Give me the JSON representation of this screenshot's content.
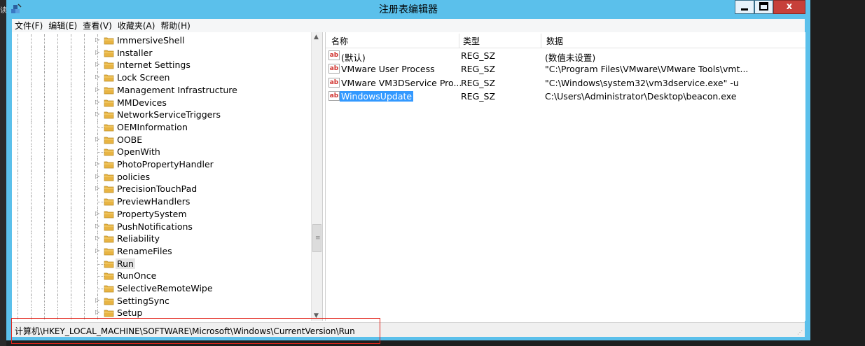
{
  "window": {
    "title": "注册表编辑器",
    "close_label": "x"
  },
  "left_edge": {
    "char": "读"
  },
  "menu": [
    {
      "label": "文件(F)"
    },
    {
      "label": "编辑(E)"
    },
    {
      "label": "查看(V)"
    },
    {
      "label": "收藏夹(A)"
    },
    {
      "label": "帮助(H)"
    }
  ],
  "tree": {
    "items": [
      {
        "label": "ImmersiveShell",
        "expandable": true
      },
      {
        "label": "Installer",
        "expandable": true
      },
      {
        "label": "Internet Settings",
        "expandable": true
      },
      {
        "label": "Lock Screen",
        "expandable": true
      },
      {
        "label": "Management Infrastructure",
        "expandable": true
      },
      {
        "label": "MMDevices",
        "expandable": true
      },
      {
        "label": "NetworkServiceTriggers",
        "expandable": true
      },
      {
        "label": "OEMInformation",
        "expandable": false
      },
      {
        "label": "OOBE",
        "expandable": true
      },
      {
        "label": "OpenWith",
        "expandable": false
      },
      {
        "label": "PhotoPropertyHandler",
        "expandable": true
      },
      {
        "label": "policies",
        "expandable": true
      },
      {
        "label": "PrecisionTouchPad",
        "expandable": true
      },
      {
        "label": "PreviewHandlers",
        "expandable": false
      },
      {
        "label": "PropertySystem",
        "expandable": true
      },
      {
        "label": "PushNotifications",
        "expandable": true
      },
      {
        "label": "Reliability",
        "expandable": true
      },
      {
        "label": "RenameFiles",
        "expandable": true
      },
      {
        "label": "Run",
        "expandable": false,
        "selected": true
      },
      {
        "label": "RunOnce",
        "expandable": false
      },
      {
        "label": "SelectiveRemoteWipe",
        "expandable": false
      },
      {
        "label": "SettingSync",
        "expandable": true
      },
      {
        "label": "Setup",
        "expandable": true
      }
    ]
  },
  "list": {
    "headers": {
      "name": "名称",
      "type": "类型",
      "data": "数据"
    },
    "rows": [
      {
        "name": "(默认)",
        "type": "REG_SZ",
        "data": "(数值未设置)",
        "selected": false
      },
      {
        "name": "VMware User Process",
        "type": "REG_SZ",
        "data": "\"C:\\Program Files\\VMware\\VMware Tools\\vmt...",
        "selected": false
      },
      {
        "name": "VMware VM3DService Pro...",
        "type": "REG_SZ",
        "data": "\"C:\\Windows\\system32\\vm3dservice.exe\" -u",
        "selected": false
      },
      {
        "name": "WindowsUpdate",
        "type": "REG_SZ",
        "data": "C:\\Users\\Administrator\\Desktop\\beacon.exe",
        "selected": true
      }
    ],
    "value_icon": "ab"
  },
  "status": {
    "path": "计算机\\HKEY_LOCAL_MACHINE\\SOFTWARE\\Microsoft\\Windows\\CurrentVersion\\Run"
  },
  "colors": {
    "titlebar": "#5bc0eb",
    "selection": "#3399ff",
    "highlight_box": "#e2231a",
    "close_button": "#c7403a"
  }
}
